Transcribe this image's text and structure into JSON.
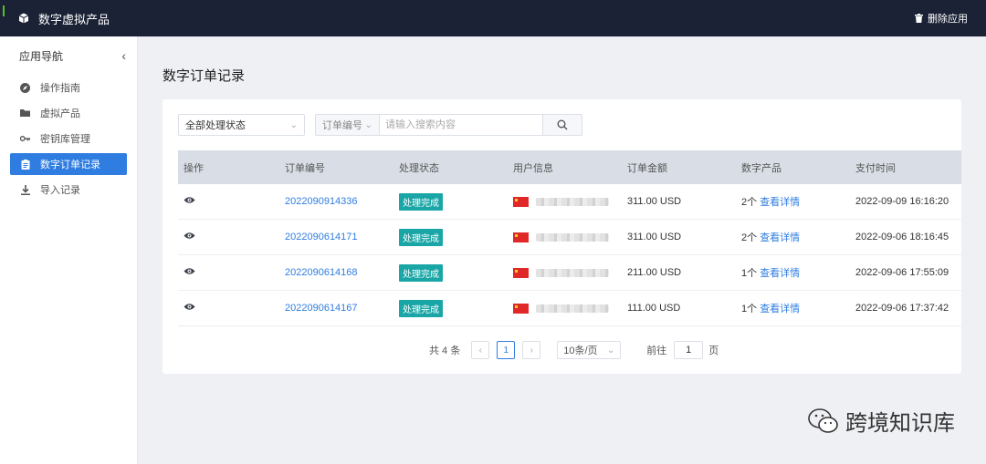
{
  "app": {
    "title": "数字虚拟产品",
    "delete_label": "删除应用"
  },
  "sidebar": {
    "title": "应用导航",
    "items": [
      {
        "label": "操作指南",
        "icon": "compass-icon"
      },
      {
        "label": "虚拟产品",
        "icon": "folder-icon"
      },
      {
        "label": "密钥库管理",
        "icon": "key-icon"
      },
      {
        "label": "数字订单记录",
        "icon": "clipboard-icon",
        "active": true
      },
      {
        "label": "导入记录",
        "icon": "download-icon"
      }
    ]
  },
  "page": {
    "title": "数字订单记录"
  },
  "filters": {
    "status_value": "全部处理状态",
    "search_type": "订单编号",
    "search_placeholder": "请输入搜索内容"
  },
  "table": {
    "headers": [
      "操作",
      "订单编号",
      "处理状态",
      "用户信息",
      "订单金额",
      "数字产品",
      "支付时间"
    ],
    "rows": [
      {
        "order_no": "2022090914336",
        "status": "处理完成",
        "amount": "311.00 USD",
        "count": "2个",
        "detail": "查看详情",
        "paid_at": "2022-09-09 16:16:20"
      },
      {
        "order_no": "2022090614171",
        "status": "处理完成",
        "amount": "311.00 USD",
        "count": "2个",
        "detail": "查看详情",
        "paid_at": "2022-09-06 18:16:45"
      },
      {
        "order_no": "2022090614168",
        "status": "处理完成",
        "amount": "211.00 USD",
        "count": "1个",
        "detail": "查看详情",
        "paid_at": "2022-09-06 17:55:09"
      },
      {
        "order_no": "2022090614167",
        "status": "处理完成",
        "amount": "111.00 USD",
        "count": "1个",
        "detail": "查看详情",
        "paid_at": "2022-09-06 17:37:42"
      }
    ]
  },
  "pagination": {
    "total": "共 4 条",
    "current": "1",
    "page_size": "10条/页",
    "goto_label": "前往",
    "goto_value": "1",
    "page_unit": "页"
  },
  "watermark": {
    "text": "跨境知识库"
  },
  "colors": {
    "topbar": "#1b2236",
    "accent": "#2f7de1",
    "status_tag": "#1aa6a6"
  }
}
